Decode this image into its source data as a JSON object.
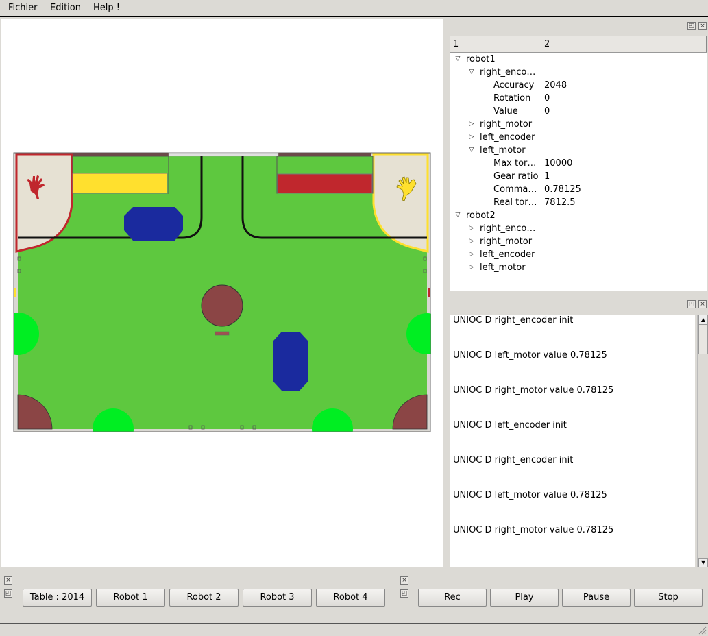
{
  "menubar": {
    "file": "Fichier",
    "edit": "Edition",
    "help": "Help !"
  },
  "tree": {
    "columns": [
      "1",
      "2"
    ],
    "rows": [
      {
        "label": "robot1",
        "value": "",
        "level": 0,
        "arrow": "open"
      },
      {
        "label": "right_enco…",
        "value": "",
        "level": 1,
        "arrow": "open"
      },
      {
        "label": "Accuracy",
        "value": "2048",
        "level": 2,
        "arrow": ""
      },
      {
        "label": "Rotation",
        "value": "0",
        "level": 2,
        "arrow": ""
      },
      {
        "label": "Value",
        "value": "0",
        "level": 2,
        "arrow": ""
      },
      {
        "label": "right_motor",
        "value": "",
        "level": 1,
        "arrow": "closed"
      },
      {
        "label": "left_encoder",
        "value": "",
        "level": 1,
        "arrow": "closed"
      },
      {
        "label": "left_motor",
        "value": "",
        "level": 1,
        "arrow": "open"
      },
      {
        "label": "Max tor…",
        "value": "10000",
        "level": 2,
        "arrow": ""
      },
      {
        "label": "Gear ratio",
        "value": "1",
        "level": 2,
        "arrow": ""
      },
      {
        "label": "Comma…",
        "value": "0.78125",
        "level": 2,
        "arrow": ""
      },
      {
        "label": "Real tor…",
        "value": "7812.5",
        "level": 2,
        "arrow": ""
      },
      {
        "label": "robot2",
        "value": "",
        "level": 0,
        "arrow": "open"
      },
      {
        "label": "right_enco…",
        "value": "",
        "level": 1,
        "arrow": "closed"
      },
      {
        "label": "right_motor",
        "value": "",
        "level": 1,
        "arrow": "closed"
      },
      {
        "label": "left_encoder",
        "value": "",
        "level": 1,
        "arrow": "closed"
      },
      {
        "label": "left_motor",
        "value": "",
        "level": 1,
        "arrow": "closed"
      }
    ]
  },
  "log": [
    "UNIOC D right_encoder init",
    "UNIOC D left_motor value 0.78125",
    "UNIOC D right_motor value 0.78125",
    "UNIOC D left_encoder init",
    "UNIOC D right_encoder init",
    "UNIOC D left_motor value 0.78125",
    "UNIOC D right_motor value 0.78125"
  ],
  "toolbar_left": [
    "Table : 2014",
    "Robot 1",
    "Robot 2",
    "Robot 3",
    "Robot 4"
  ],
  "toolbar_right": [
    "Rec",
    "Play",
    "Pause",
    "Stop"
  ],
  "arrow_glyphs": {
    "open": "▽",
    "closed": "▷"
  },
  "dock_glyphs": {
    "float": "◰",
    "close": "×"
  },
  "colors": {
    "field_green": "#5ec83f",
    "red_team": "#c0272d",
    "yellow_team": "#ffe02e",
    "fire_blue": "#1a2a9e",
    "tree_brown": "#8b4545",
    "circle_green": "#00ee22",
    "start_zone": "#e6e1d3"
  }
}
